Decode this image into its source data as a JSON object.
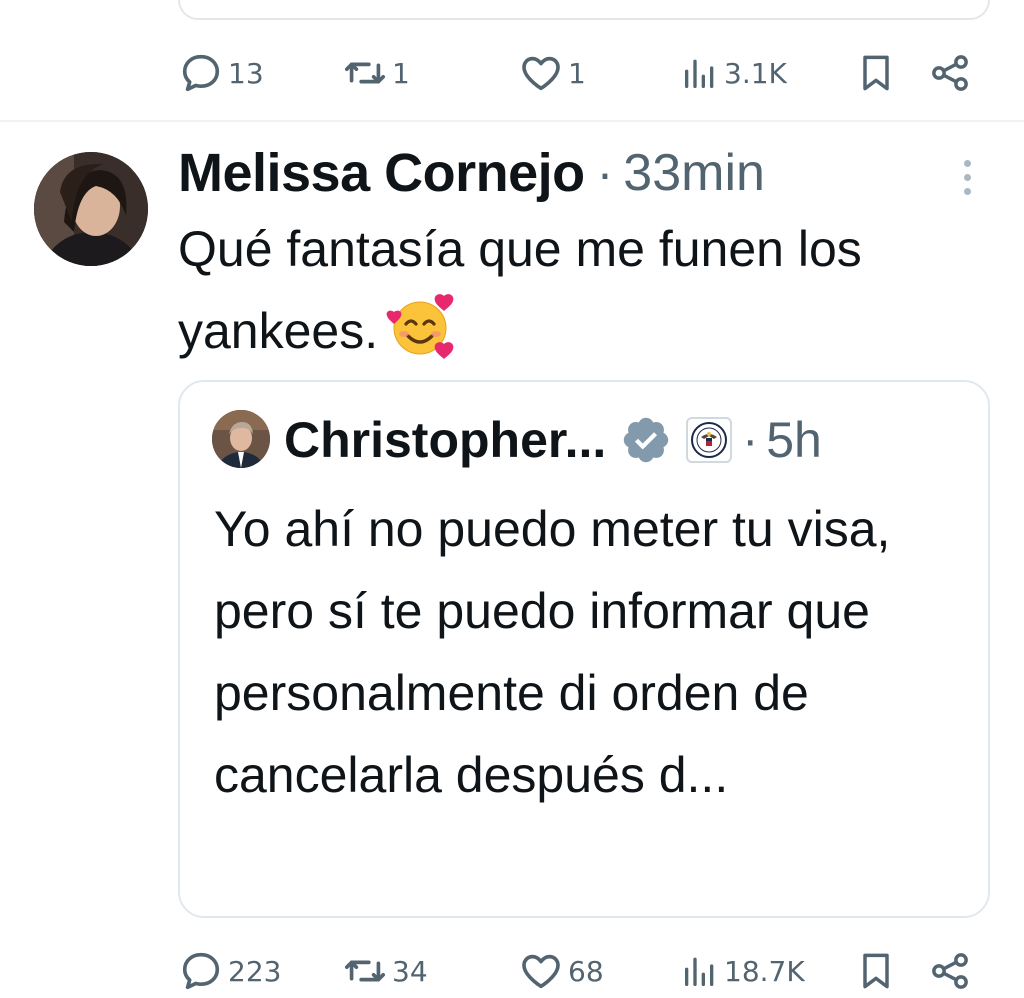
{
  "previous_tweet": {
    "actions": {
      "replies": "13",
      "retweets": "1",
      "likes": "1",
      "views": "3.1K"
    }
  },
  "tweet": {
    "author_name": "Melissa Cornejo",
    "separator": "·",
    "timestamp": "33min",
    "text": "Qué fantasía que me funen los yankees.",
    "emoji_icon": "smiling-face-with-hearts-icon",
    "quoted": {
      "author_name": "Christopher...",
      "separator": "·",
      "timestamp": "5h",
      "text": "Yo ahí no puedo meter tu visa, pero sí te puedo informar que personalmente di orden de cancelarla después d...",
      "verified_color": "#829aab"
    },
    "actions": {
      "replies": "223",
      "retweets": "34",
      "likes": "68",
      "views": "18.7K"
    }
  },
  "colors": {
    "secondary_text": "#536471",
    "primary_text": "#0f1419",
    "border": "#e1e8ed"
  }
}
